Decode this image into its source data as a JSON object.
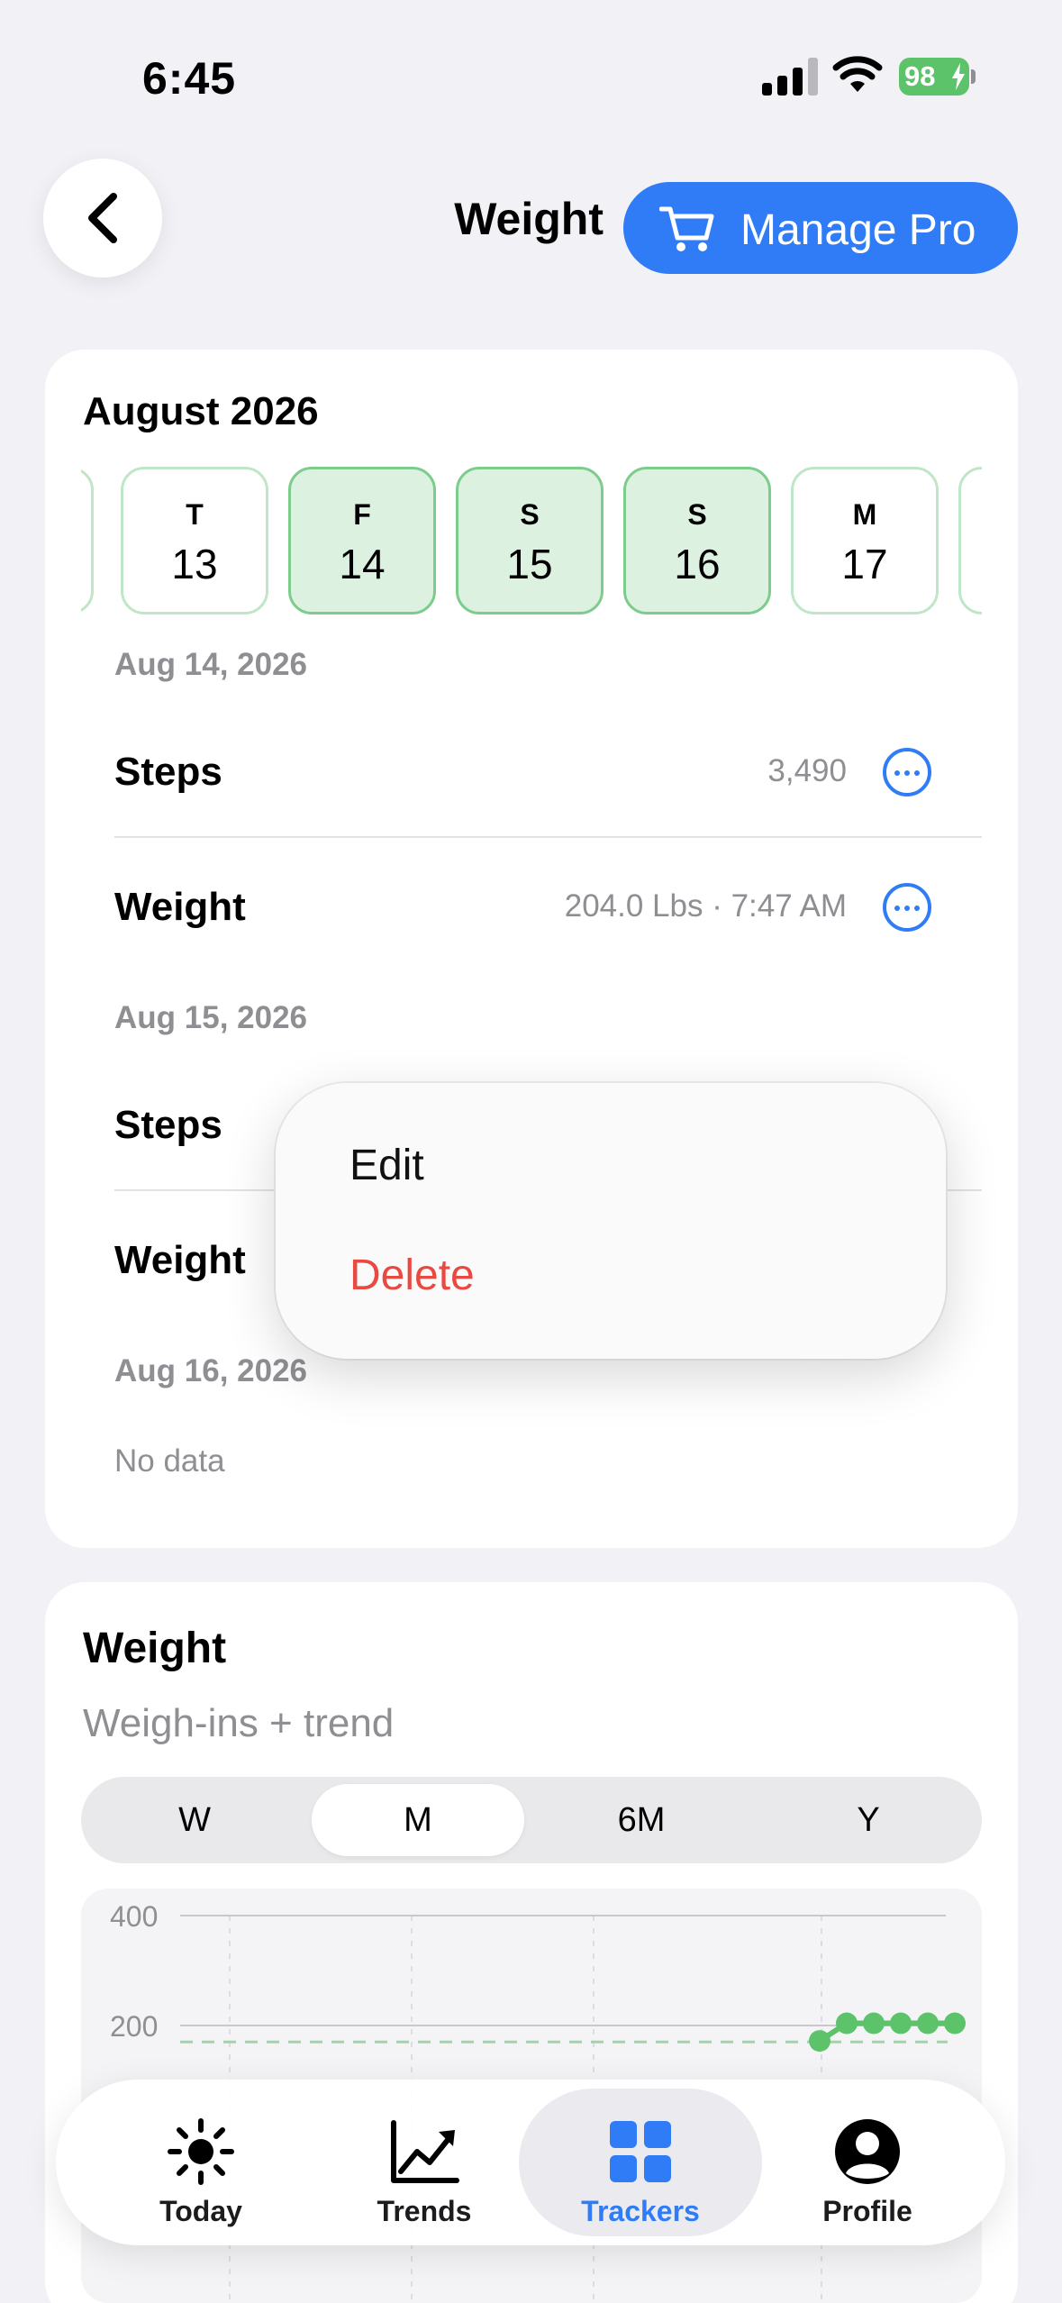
{
  "status_bar": {
    "time": "6:45",
    "battery": "98"
  },
  "header": {
    "title": "Weight",
    "manage_pro_label": "Manage Pro"
  },
  "calendar": {
    "month_title": "August 2026",
    "days": [
      {
        "dow": "T",
        "num": "13",
        "active": false
      },
      {
        "dow": "F",
        "num": "14",
        "active": true
      },
      {
        "dow": "S",
        "num": "15",
        "active": true
      },
      {
        "dow": "S",
        "num": "16",
        "active": true
      },
      {
        "dow": "M",
        "num": "17",
        "active": false
      }
    ]
  },
  "log": {
    "sections": [
      {
        "date": "Aug 14, 2026",
        "entries": [
          {
            "label": "Steps",
            "value": "3,490"
          },
          {
            "label": "Weight",
            "value": "204.0 Lbs · 7:47 AM"
          }
        ]
      },
      {
        "date": "Aug 15, 2026",
        "entries": [
          {
            "label": "Steps",
            "value": ""
          },
          {
            "label": "Weight",
            "value": ""
          }
        ]
      },
      {
        "date": "Aug 16, 2026",
        "empty_text": "No data"
      }
    ]
  },
  "context_menu": {
    "edit_label": "Edit",
    "delete_label": "Delete",
    "delete_color": "#e84a42"
  },
  "weight_chart": {
    "title": "Weight",
    "subtitle": "Weigh-ins + trend",
    "ranges": [
      "W",
      "M",
      "6M",
      "Y"
    ],
    "selected_range": "M"
  },
  "chart_data": {
    "type": "line",
    "title": "Weight",
    "subtitle": "Weigh-ins + trend",
    "y_ticks": [
      "400",
      "200"
    ],
    "ylim": [
      0,
      400
    ],
    "series": [
      {
        "values": [
          172,
          204,
          204,
          204,
          204,
          204
        ],
        "color": "#5dc36b"
      }
    ],
    "trend_line": {
      "value": 170,
      "style": "dashed",
      "color": "#9fd5a8"
    }
  },
  "tabbar": {
    "tabs": [
      {
        "label": "Today",
        "icon": "sun-icon"
      },
      {
        "label": "Trends",
        "icon": "trend-chart-icon"
      },
      {
        "label": "Trackers",
        "icon": "grid-icon"
      },
      {
        "label": "Profile",
        "icon": "person-circle-icon"
      }
    ],
    "selected": "Trackers"
  },
  "colors": {
    "accent": "#2f7cf6",
    "positive": "#5dc36b",
    "background": "#f1f1f6"
  }
}
